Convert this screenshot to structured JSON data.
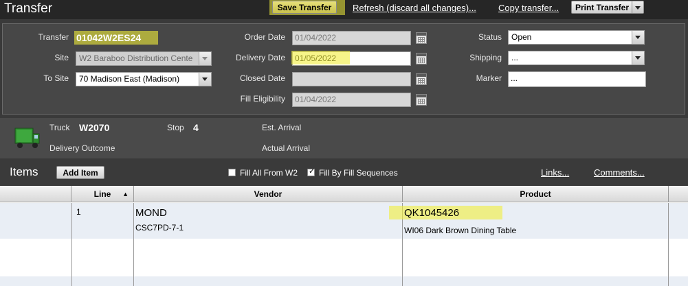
{
  "header": {
    "title": "Transfer",
    "save_label": "Save Transfer",
    "refresh_label": "Refresh (discard all changes)...",
    "copy_label": "Copy transfer...",
    "print_label": "Print Transfer"
  },
  "form": {
    "transfer_label": "Transfer",
    "transfer_value": "01042W2ES24",
    "site_label": "Site",
    "site_value": "W2  Baraboo Distribution Cente",
    "to_site_label": "To Site",
    "to_site_value": "70  Madison East  (Madison)",
    "order_date_label": "Order Date",
    "order_date_value": "01/04/2022",
    "delivery_date_label": "Delivery Date",
    "delivery_date_value": "01/05/2022",
    "closed_date_label": "Closed Date",
    "closed_date_value": "",
    "fill_eligibility_label": "Fill Eligibility",
    "fill_eligibility_value": "01/04/2022",
    "status_label": "Status",
    "status_value": "Open",
    "shipping_label": "Shipping",
    "shipping_value": "...",
    "marker_label": "Marker",
    "marker_value": "..."
  },
  "truck": {
    "truck_label": "Truck",
    "truck_value": "W2070",
    "stop_label": "Stop",
    "stop_value": "4",
    "est_arrival_label": "Est. Arrival",
    "delivery_outcome_label": "Delivery Outcome",
    "actual_arrival_label": "Actual Arrival"
  },
  "items": {
    "title": "Items",
    "add_item_label": "Add Item",
    "fill_all_label": "Fill All From W2",
    "fill_all_checked": false,
    "fill_by_seq_label": "Fill By Fill Sequences",
    "fill_by_seq_checked": true,
    "links_label": "Links...",
    "comments_label": "Comments..."
  },
  "table": {
    "columns": [
      "",
      "Line",
      "Vendor",
      "Product"
    ],
    "sort_indicator": "▲",
    "rows": [
      {
        "line": "1",
        "vendor_name": "MOND",
        "vendor_code": "CSC7PD-7-1",
        "product_code": "QK1045426",
        "product_desc": "WI06 Dark Brown Dining Table"
      }
    ]
  },
  "colors": {
    "highlight": "#f2ef3a",
    "background": "#3a3a3a"
  }
}
